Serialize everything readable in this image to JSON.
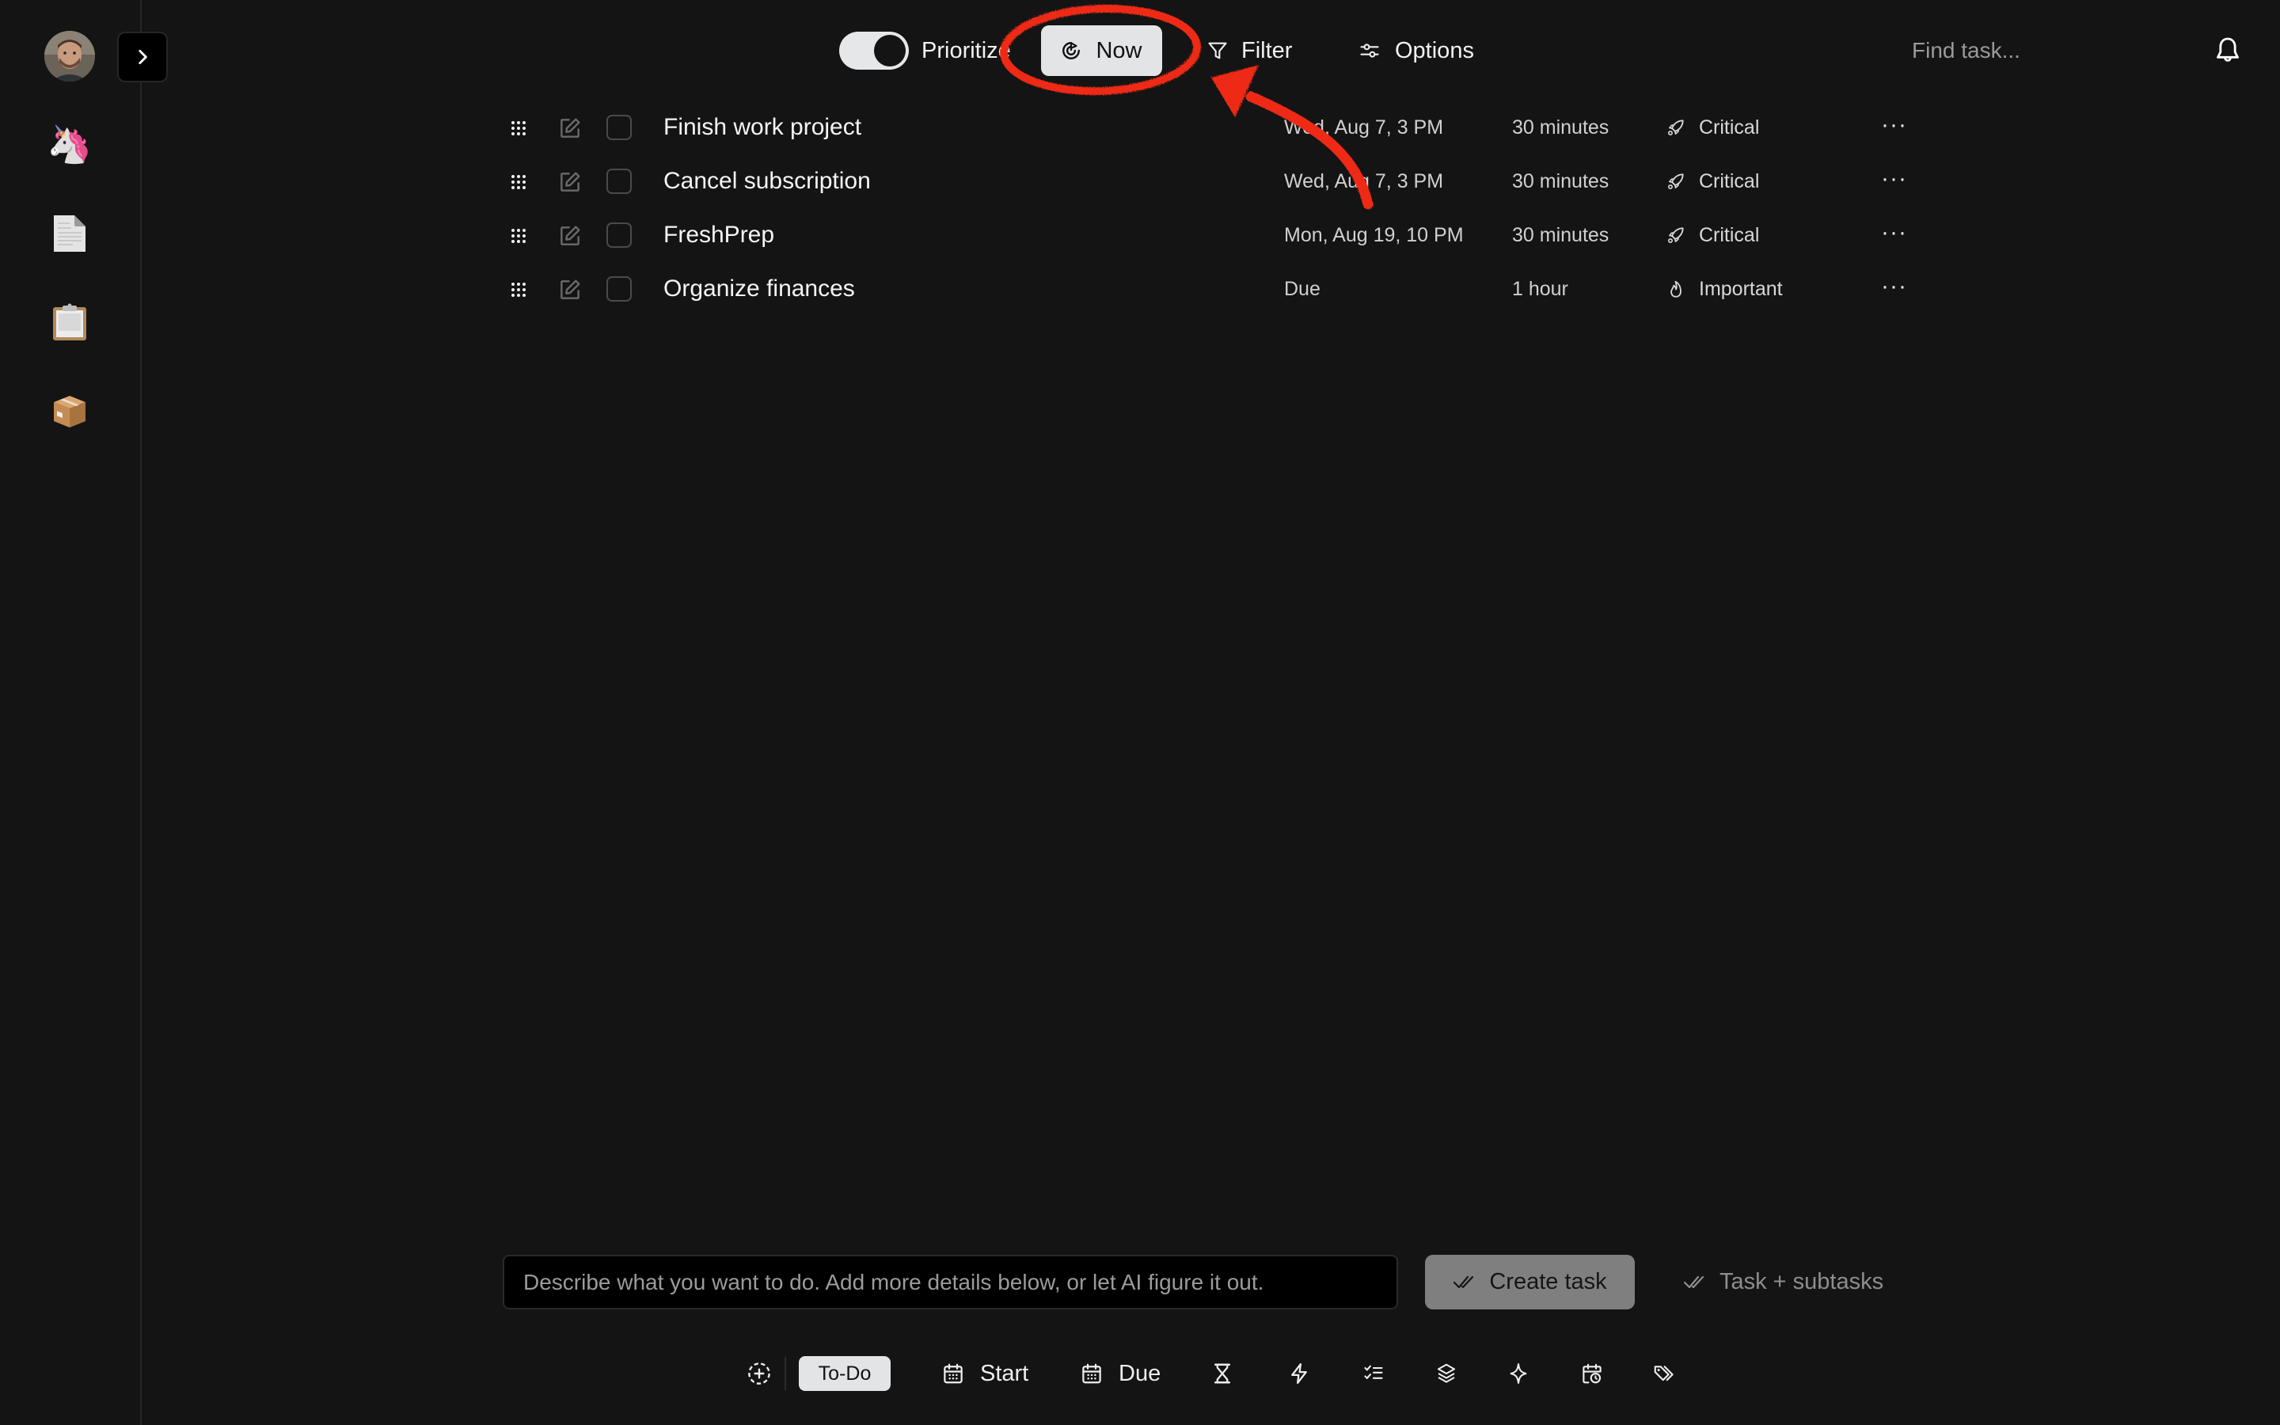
{
  "sidebar": {
    "avatar_label": "User avatar",
    "expand_label": ">",
    "items": [
      {
        "name": "unicorn",
        "glyph": "🦄"
      },
      {
        "name": "document",
        "glyph": "📄"
      },
      {
        "name": "clipboard",
        "glyph": "📋"
      },
      {
        "name": "package",
        "glyph": "📦"
      }
    ]
  },
  "topbar": {
    "prioritize_label": "Prioritize",
    "prioritize_on": true,
    "now_label": "Now",
    "filter_label": "Filter",
    "options_label": "Options",
    "search_placeholder": "Find task..."
  },
  "tasks": [
    {
      "title": "Finish work project",
      "date": "Wed, Aug 7, 3 PM",
      "duration": "30 minutes",
      "priority": "Critical",
      "priority_icon": "rocket-icon",
      "more": "···"
    },
    {
      "title": "Cancel subscription",
      "date": "Wed, Aug 7, 3 PM",
      "duration": "30 minutes",
      "priority": "Critical",
      "priority_icon": "rocket-icon",
      "more": "···"
    },
    {
      "title": "FreshPrep",
      "date": "Mon, Aug 19, 10 PM",
      "duration": "30 minutes",
      "priority": "Critical",
      "priority_icon": "rocket-icon",
      "more": "···"
    },
    {
      "title": "Organize finances",
      "date": "Due",
      "duration": "1 hour",
      "priority": "Important",
      "priority_icon": "flame-icon",
      "more": "···"
    }
  ],
  "composer": {
    "placeholder": "Describe what you want to do. Add more details below, or let AI figure it out.",
    "value": "",
    "create_label": "Create task",
    "subtasks_label": "Task + subtasks"
  },
  "toolbar": {
    "status_label": "To-Do",
    "start_label": "Start",
    "due_label": "Due",
    "icons": [
      "add-circle-icon",
      "hourglass-icon",
      "lightning-icon",
      "checklist-icon",
      "layers-icon",
      "sparkle-icon",
      "calendar-clock-icon",
      "tags-icon"
    ]
  },
  "colors": {
    "background": "#141414",
    "annotation": "#ee2a12",
    "pill": "#e3e4e6",
    "create_button": "#7f7f7f"
  }
}
